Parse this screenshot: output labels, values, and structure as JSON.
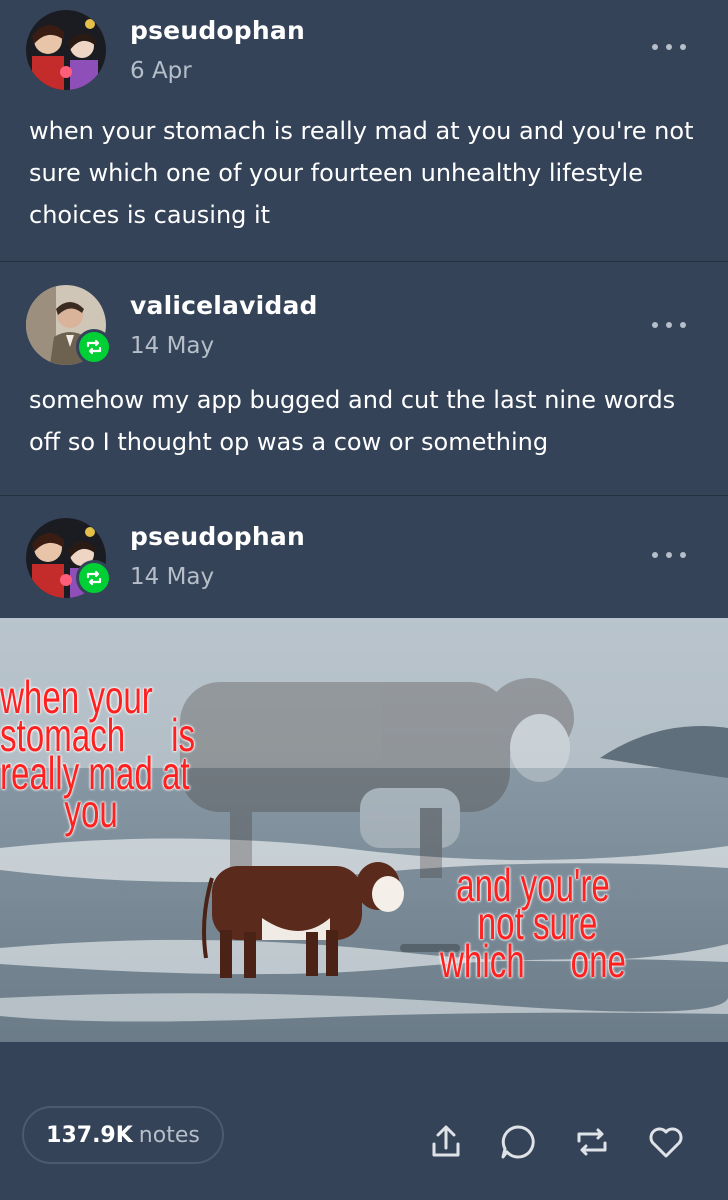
{
  "posts": [
    {
      "username": "pseudophan",
      "date": "6 Apr",
      "text": "when your stomach is really mad at you and you're not sure which one of your fourteen unhealthy lifestyle choices is causing it",
      "is_reblog": false
    },
    {
      "username": "valicelavidad",
      "date": "14 May",
      "text": "somehow my app bugged and cut the last nine words off so I thought op was a cow or something",
      "is_reblog": true
    },
    {
      "username": "pseudophan",
      "date": "14 May",
      "is_reblog": true,
      "image": {
        "caption_left": "when your\nstomach     is\nreally mad at\n       you",
        "caption_right": "and you're\n not sure\nwhich     one"
      }
    }
  ],
  "footer": {
    "notes_count": "137.9K",
    "notes_label": "notes",
    "actions": [
      "share-icon",
      "reply-icon",
      "reblog-icon",
      "heart-icon"
    ]
  },
  "colors": {
    "background": "#344358",
    "reblog_badge": "#00cf35",
    "secondary_text": "#b6bec9",
    "meme_text": "#ff2020"
  }
}
